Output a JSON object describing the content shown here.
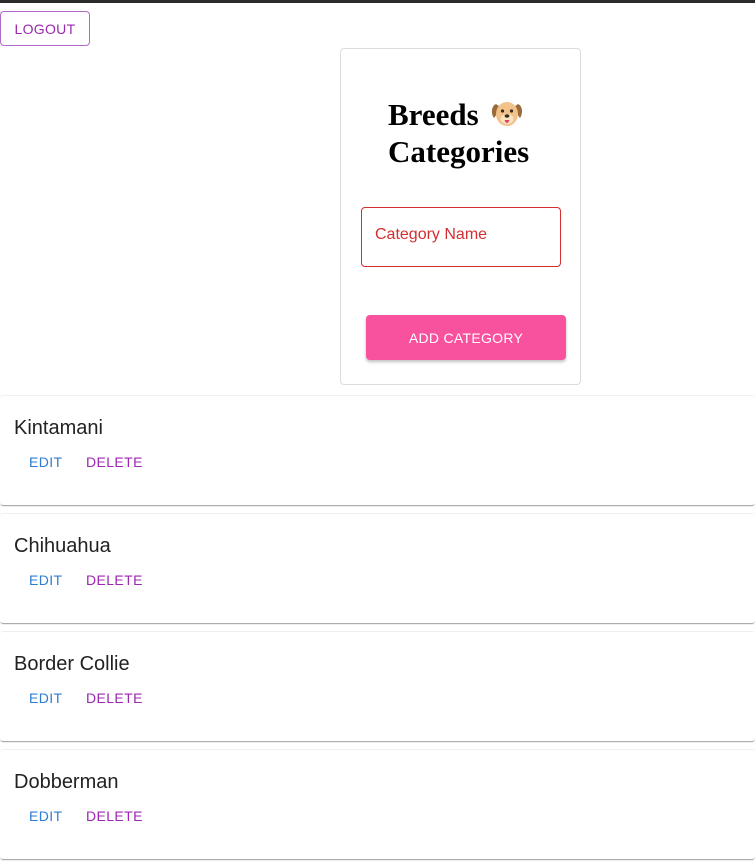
{
  "header": {
    "logout_label": "LOGOUT"
  },
  "form": {
    "title_line1": "Breeds",
    "title_line2": "Categories",
    "title_icon": "dog-face-icon",
    "field_label": "Category Name",
    "field_value": "",
    "submit_label": "ADD CATEGORY"
  },
  "categories": [
    {
      "name": "Kintamani",
      "edit_label": "EDIT",
      "delete_label": "DELETE"
    },
    {
      "name": "Chihuahua",
      "edit_label": "EDIT",
      "delete_label": "DELETE"
    },
    {
      "name": "Border Collie",
      "edit_label": "EDIT",
      "delete_label": "DELETE"
    },
    {
      "name": "Dobberman",
      "edit_label": "EDIT",
      "delete_label": "DELETE"
    }
  ],
  "colors": {
    "primary_pink": "#f8519d",
    "secondary_purple": "#9c27b0",
    "edit_blue": "#2f7cd0",
    "error_red": "#d32f2f"
  }
}
